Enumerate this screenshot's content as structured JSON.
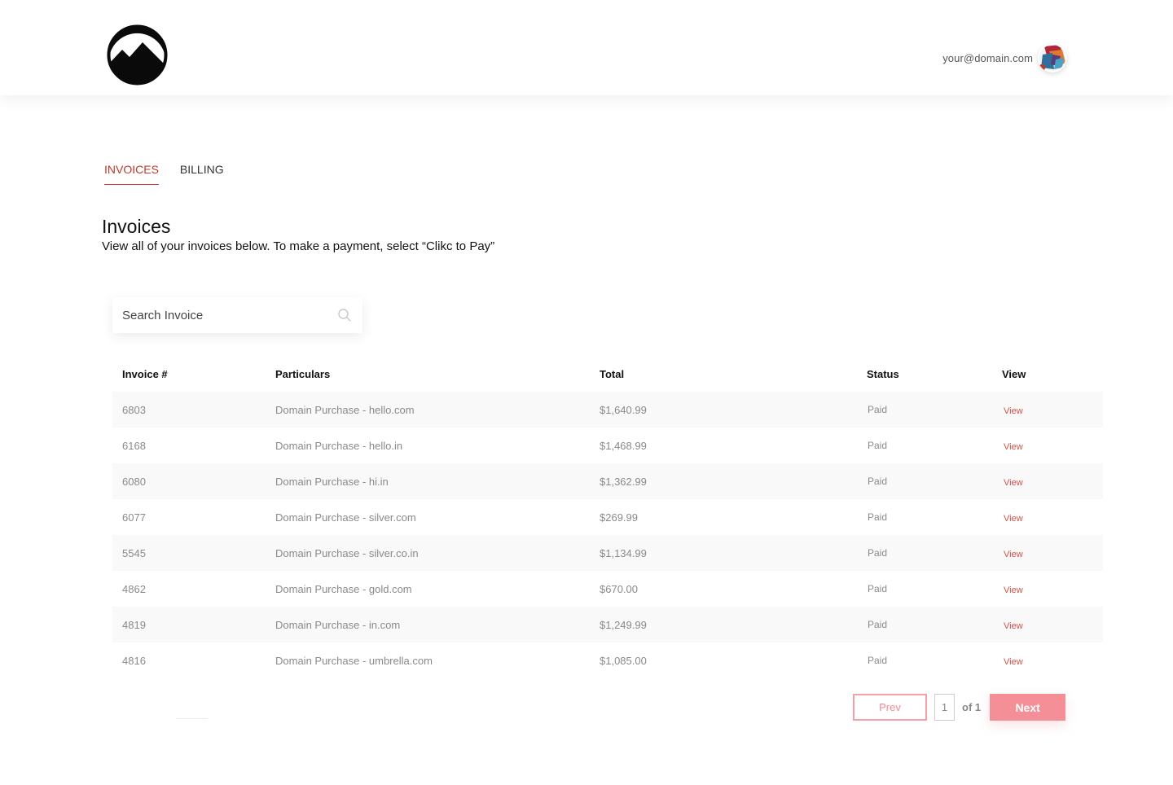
{
  "header": {
    "user_email": "your@domain.com"
  },
  "tabs": [
    {
      "label": "INVOICES",
      "active": true
    },
    {
      "label": "BILLING",
      "active": false
    }
  ],
  "page": {
    "title": "Invoices",
    "subtitle": "View all of your invoices below. To make a payment, select “Clikc to Pay”"
  },
  "search": {
    "placeholder": "Search Invoice"
  },
  "table": {
    "columns": [
      "Invoice #",
      "Particulars",
      "Total",
      "Status",
      "View"
    ],
    "rows": [
      {
        "invoice": "6803",
        "particulars": "Domain Purchase - hello.com",
        "total": "$1,640.99",
        "status": "Paid",
        "view": "View"
      },
      {
        "invoice": "6168",
        "particulars": "Domain Purchase - hello.in",
        "total": "$1,468.99",
        "status": "Paid",
        "view": "View"
      },
      {
        "invoice": "6080",
        "particulars": "Domain Purchase - hi.in",
        "total": "$1,362.99",
        "status": "Paid",
        "view": "View"
      },
      {
        "invoice": "6077",
        "particulars": "Domain Purchase - silver.com",
        "total": "$269.99",
        "status": "Paid",
        "view": "View"
      },
      {
        "invoice": "5545",
        "particulars": "Domain Purchase - silver.co.in",
        "total": "$1,134.99",
        "status": "Paid",
        "view": "View"
      },
      {
        "invoice": "4862",
        "particulars": "Domain Purchase - gold.com",
        "total": "$670.00",
        "status": "Paid",
        "view": "View"
      },
      {
        "invoice": "4819",
        "particulars": "Domain Purchase - in.com",
        "total": "$1,249.99",
        "status": "Paid",
        "view": "View"
      },
      {
        "invoice": "4816",
        "particulars": "Domain Purchase - umbrella.com",
        "total": "$1,085.00",
        "status": "Paid",
        "view": "View"
      }
    ]
  },
  "pagination": {
    "prev_label": "Prev",
    "current_page": "1",
    "of_label": "of 1",
    "next_label": "Next"
  },
  "colors": {
    "accent": "#c0392b",
    "link": "#d0504a",
    "next_button": "#f58f97",
    "prev_border": "#f4a0a6"
  },
  "icons": {
    "logo": "mountain-circle-logo",
    "search": "search-icon"
  }
}
